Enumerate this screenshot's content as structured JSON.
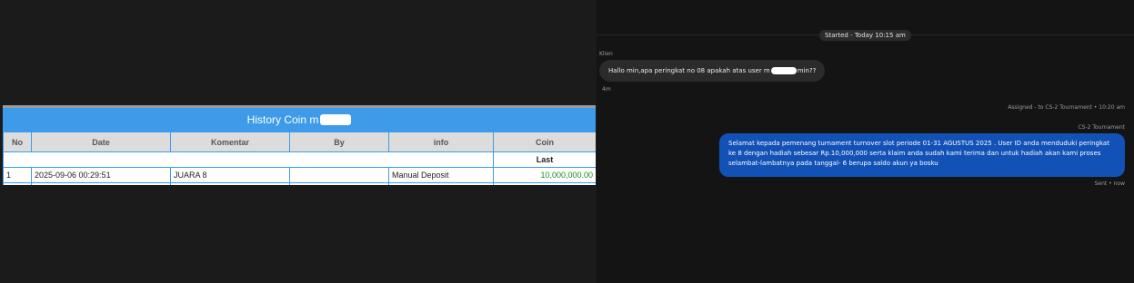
{
  "coin_history": {
    "title_prefix": "History Coin m",
    "columns": [
      "No",
      "Date",
      "Komentar",
      "By",
      "info",
      "Coin"
    ],
    "subheader_last": "Last",
    "rows": [
      {
        "no": "1",
        "date": "2025-09-06 00:29:51",
        "komentar": "JUARA 8",
        "by": "",
        "info": "Manual Deposit",
        "coin": "10,000,000.00"
      }
    ]
  },
  "chat": {
    "started": "Started - Today 10:15 am",
    "sender_label": "Klien",
    "incoming_text_before": "Hallo min,apa peringkat no 08 apakah atas user m",
    "incoming_text_after": "min??",
    "incoming_time": "4m",
    "assigned": "Assigned - to CS-2 Tournament • 10:20 am",
    "agent_label": "CS-2 Tournament",
    "outgoing_text": "Selamat kepada pemenang turnament turnover slot periode 01-31 AGUSTUS 2025 . User ID anda menduduki peringkat ke 8 dengan hadiah sebesar Rp.10,000,000 serta klaim anda sudah kami terima dan untuk hadiah akan kami proses selambat-lambatnya pada tanggal- 6 berupa saldo akun ya bosku",
    "outgoing_status": "Sent • now"
  },
  "colors": {
    "table_header_blue": "#3d9be9",
    "coin_green": "#1e8a1e",
    "outgoing_bubble": "#1252b6",
    "incoming_bubble": "#2b2b2b"
  }
}
